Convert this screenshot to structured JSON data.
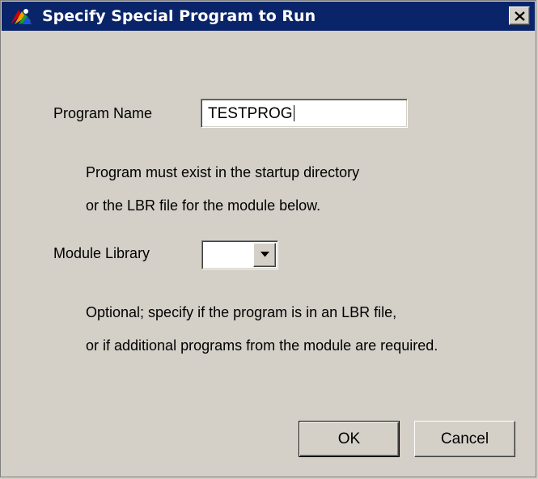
{
  "window": {
    "title": "Specify Special Program to Run",
    "icon": "app-icon",
    "close_icon": "close-icon"
  },
  "program_name": {
    "label": "Program Name",
    "value": "TESTPROG",
    "help_line1": "Program must exist in the startup directory",
    "help_line2": "or the LBR file for the module below."
  },
  "module_library": {
    "label": "Module Library",
    "selected": "",
    "dropdown_icon": "chevron-down-icon",
    "help_line1": "Optional; specify if the program is in an LBR file,",
    "help_line2": "or if additional programs from the module are required."
  },
  "buttons": {
    "ok": "OK",
    "cancel": "Cancel"
  },
  "colors": {
    "titlebar": "#0a246a",
    "face": "#d4d0c8"
  }
}
